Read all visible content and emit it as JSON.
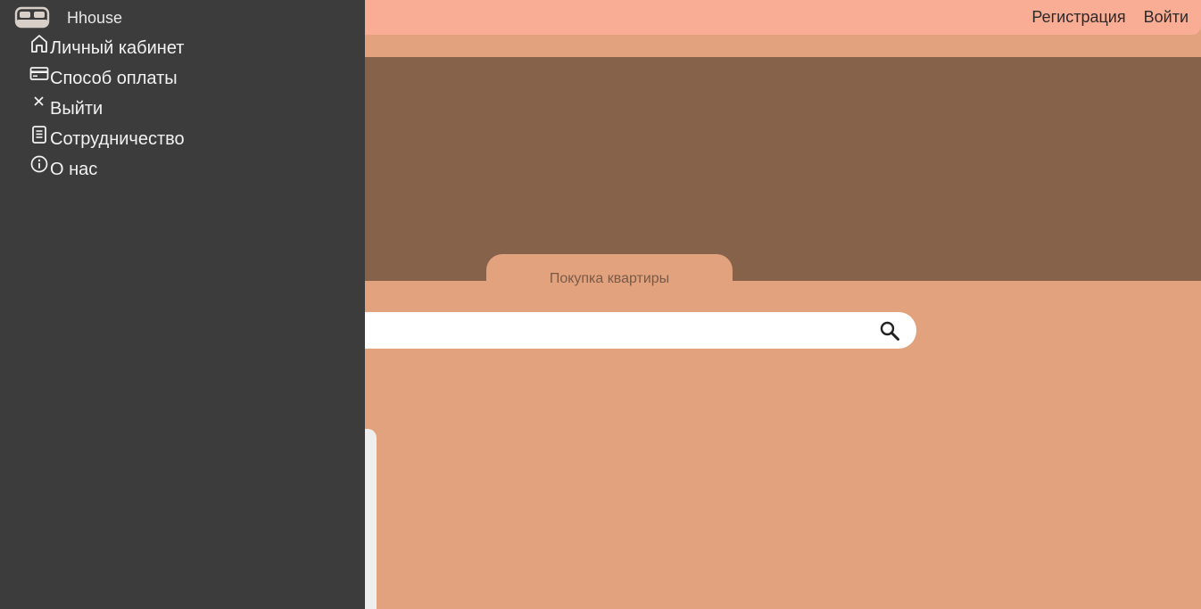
{
  "header": {
    "register_label": "Регистрация",
    "login_label": "Войти"
  },
  "hero": {
    "tab_label": "Покупка квартиры"
  },
  "search": {
    "placeholder": ""
  },
  "sidebar": {
    "brand": "Hhouse",
    "items": [
      {
        "label": "Личный кабинет",
        "icon": "home-icon"
      },
      {
        "label": "Способ оплаты",
        "icon": "credit-card-icon"
      },
      {
        "label": "Выйти",
        "icon": "close-icon"
      },
      {
        "label": "Сотрудничество",
        "icon": "document-icon"
      },
      {
        "label": "О нас",
        "icon": "info-icon"
      }
    ]
  },
  "colors": {
    "topbar": "#F9AD95",
    "page_bg": "#E2A27E",
    "hero": "#86624B",
    "sidebar": "#3C3C3C"
  }
}
